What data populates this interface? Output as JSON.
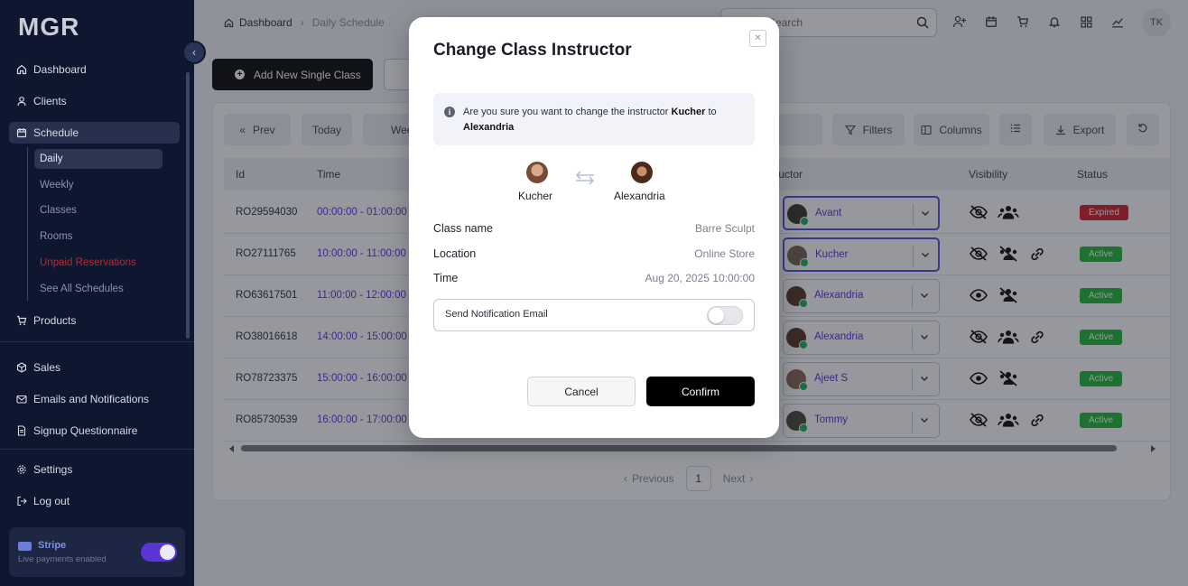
{
  "app": {
    "logo": "MGR"
  },
  "sidebar": {
    "items": [
      {
        "label": "Dashboard",
        "icon": "home-icon"
      },
      {
        "label": "Clients",
        "icon": "user-icon"
      },
      {
        "label": "Schedule",
        "icon": "calendar-icon"
      },
      {
        "label": "Products",
        "icon": "cart-icon"
      },
      {
        "label": "Sales",
        "icon": "box-icon"
      },
      {
        "label": "Emails and Notifications",
        "icon": "mail-icon"
      },
      {
        "label": "Signup Questionnaire",
        "icon": "document-icon"
      },
      {
        "label": "Settings",
        "icon": "gear-icon"
      },
      {
        "label": "Log out",
        "icon": "logout-icon"
      }
    ],
    "schedule_sub": [
      "Daily",
      "Weekly",
      "Classes",
      "Rooms",
      "Unpaid Reservations",
      "See All Schedules"
    ],
    "stripe": {
      "name": "Stripe",
      "status": "Live payments enabled"
    }
  },
  "header": {
    "breadcrumb": [
      "Dashboard",
      "Daily Schedule"
    ],
    "search_placeholder": "Search",
    "user_initials": "TK"
  },
  "toolbar": {
    "add_class": "Add New Single Class",
    "prev": "Prev",
    "today": "Today",
    "week": "Wee",
    "filters": "Filters",
    "columns": "Columns",
    "export": "Export"
  },
  "table": {
    "headers": [
      "Id",
      "Time",
      "tructor",
      "Visibility",
      "Status"
    ],
    "rows": [
      {
        "id": "RO29594030",
        "time": "00:00:00 - 01:00:00",
        "instructor": "Avant",
        "status": "Expired"
      },
      {
        "id": "RO27111765",
        "time": "10:00:00 - 11:00:00",
        "instructor": "Kucher",
        "status": "Active"
      },
      {
        "id": "RO63617501",
        "time": "11:00:00 - 12:00:00",
        "instructor": "Alexandria",
        "status": "Active"
      },
      {
        "id": "RO38016618",
        "time": "14:00:00 - 15:00:00",
        "instructor": "Alexandria",
        "status": "Active"
      },
      {
        "id": "RO78723375",
        "time": "15:00:00 - 16:00:00",
        "instructor": "Ajeet S",
        "status": "Active"
      },
      {
        "id": "RO85730539",
        "time": "16:00:00 - 17:00:00",
        "instructor": "Tommy",
        "status": "Active"
      }
    ]
  },
  "pagination": {
    "previous": "Previous",
    "page": "1",
    "next": "Next"
  },
  "modal": {
    "title": "Change Class Instructor",
    "info_prefix": "Are you sure you want to change the instructor",
    "from": "Kucher",
    "to_word": "to",
    "to": "Alexandria",
    "details": [
      {
        "label": "Class name",
        "value": "Barre Sculpt"
      },
      {
        "label": "Location",
        "value": "Online Store"
      },
      {
        "label": "Time",
        "value": "Aug 20, 2025 10:00:00"
      }
    ],
    "notify_label": "Send Notification Email",
    "cancel": "Cancel",
    "confirm": "Confirm"
  }
}
